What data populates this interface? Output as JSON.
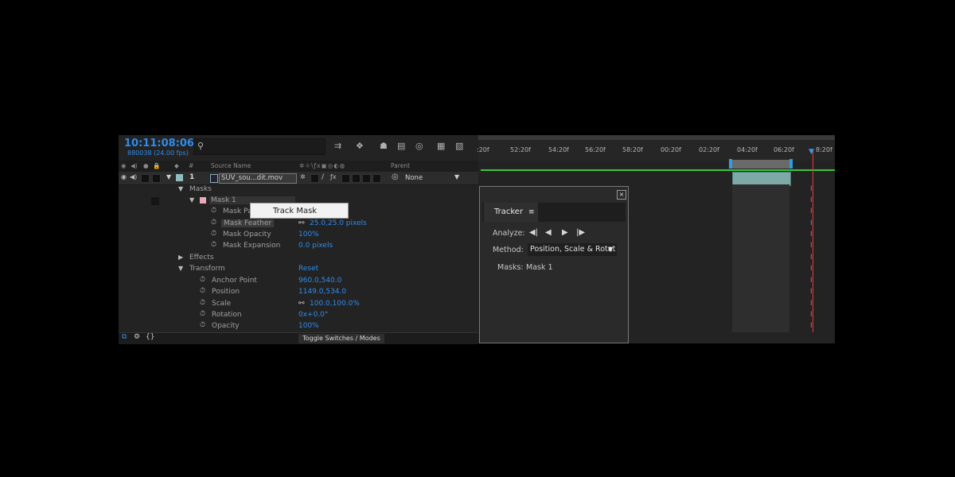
{
  "header": {
    "timecode": "10:11:08:06",
    "frame_info": "880038 (24.00 fps)",
    "search_icon": "search-icon"
  },
  "columns": {
    "index": "#",
    "source_name": "Source Name",
    "parent": "Parent"
  },
  "layer": {
    "number": "1",
    "name": "SUV_sou...dit.mov",
    "parent": "None"
  },
  "properties": {
    "masks": "Masks",
    "mask1": "Mask 1",
    "mask_path": "Mask Pa",
    "mask_feather": "Mask Feather",
    "mask_feather_val": "25.0,25.0  pixels",
    "mask_opacity": "Mask Opacity",
    "mask_opacity_val": "100%",
    "mask_expansion": "Mask Expansion",
    "mask_expansion_val": "0.0  pixels",
    "effects": "Effects",
    "transform": "Transform",
    "transform_val": "Reset",
    "anchor_point": "Anchor Point",
    "anchor_point_val": "960.0,540.0",
    "position": "Position",
    "position_val": "1149.0,534.0",
    "scale": "Scale",
    "scale_val": "100.0,100.0%",
    "rotation": "Rotation",
    "rotation_val": "0x+0.0°",
    "opacity": "Opacity",
    "opacity_val": "100%"
  },
  "popup": {
    "label": "Track Mask"
  },
  "bottom": {
    "toggle": "Toggle Switches / Modes"
  },
  "timeline": {
    "ticks": [
      ":20f",
      "52:20f",
      "54:20f",
      "56:20f",
      "58:20f",
      "00:20f",
      "02:20f",
      "04:20f",
      "06:20f",
      "8:20f"
    ]
  },
  "tracker": {
    "title": "Tracker",
    "analyze_label": "Analyze:",
    "method_label": "Method:",
    "method_value": "Position, Scale & Rotat",
    "masks_label": "Masks:",
    "masks_value": "Mask 1"
  },
  "colors": {
    "accent_blue": "#2d8ceb",
    "track_green": "#38c838",
    "cti_red": "#e03a3a"
  }
}
